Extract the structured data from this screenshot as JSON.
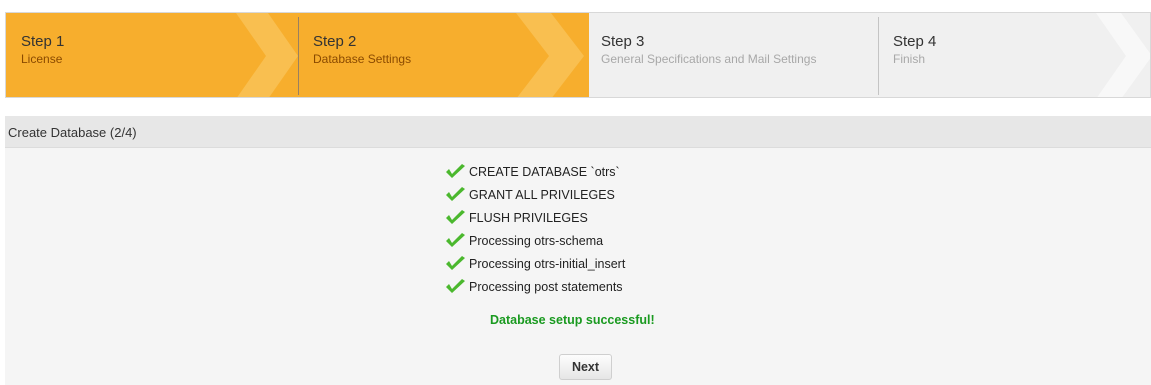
{
  "steps": [
    {
      "title": "Step 1",
      "subtitle": "License",
      "state": "done"
    },
    {
      "title": "Step 2",
      "subtitle": "Database Settings",
      "state": "done"
    },
    {
      "title": "Step 3",
      "subtitle": "General Specifications and Mail Settings",
      "state": "todo"
    },
    {
      "title": "Step 4",
      "subtitle": "Finish",
      "state": "todo"
    }
  ],
  "panel": {
    "title": "Create Database (2/4)",
    "log": [
      "CREATE DATABASE `otrs`",
      "GRANT ALL PRIVILEGES",
      "FLUSH PRIVILEGES",
      "Processing otrs-schema",
      "Processing otrs-initial_insert",
      "Processing post statements"
    ],
    "success_message": "Database setup successful!",
    "next_label": "Next"
  },
  "colors": {
    "accent": "#f7ae2d",
    "accent_light": "#f9c462",
    "check_green": "#4bb82e",
    "success_green": "#1a9a20"
  },
  "icons": {
    "log_item": "checkmark-icon"
  }
}
